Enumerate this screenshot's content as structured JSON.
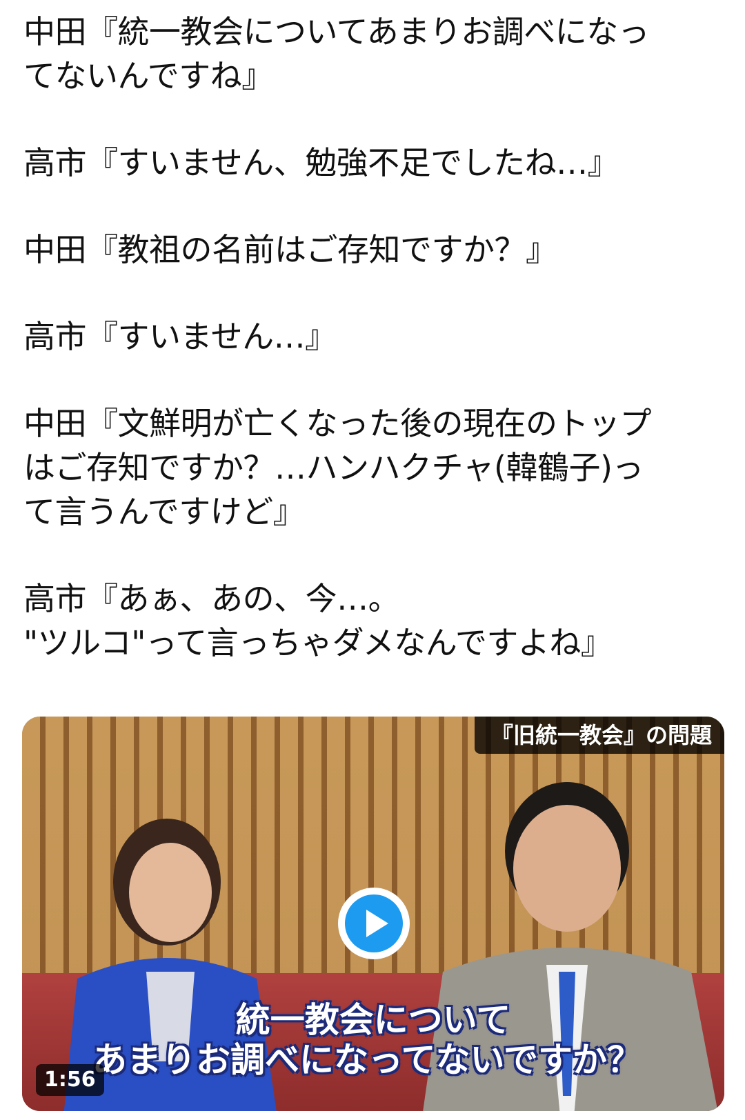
{
  "tweet": {
    "lines": [
      "中田『統一教会についてあまりお調べになっ",
      "てないんですね』",
      "高市『すいません、勉強不足でしたね…』",
      "中田『教祖の名前はご存知ですか？』",
      "高市『すいません…』",
      "中田『文鮮明が亡くなった後の現在のトップ",
      "はご存知ですか？…ハンハクチャ(韓鶴子)っ",
      "て言うんですけど』",
      "高市『あぁ、あの、今…。",
      "\"ツルコ\"って言っちゃダメなんですよね』"
    ]
  },
  "video": {
    "badge": "『旧統一教会』の問題",
    "subtitle_line1": "統一教会について",
    "subtitle_line2": "あまりお調べになってないですか？",
    "duration": "1:56",
    "colors": {
      "play_accent": "#1d9bf0",
      "subtitle_outline": "#1b2a7a"
    },
    "icons": {
      "play": "play-icon"
    }
  }
}
